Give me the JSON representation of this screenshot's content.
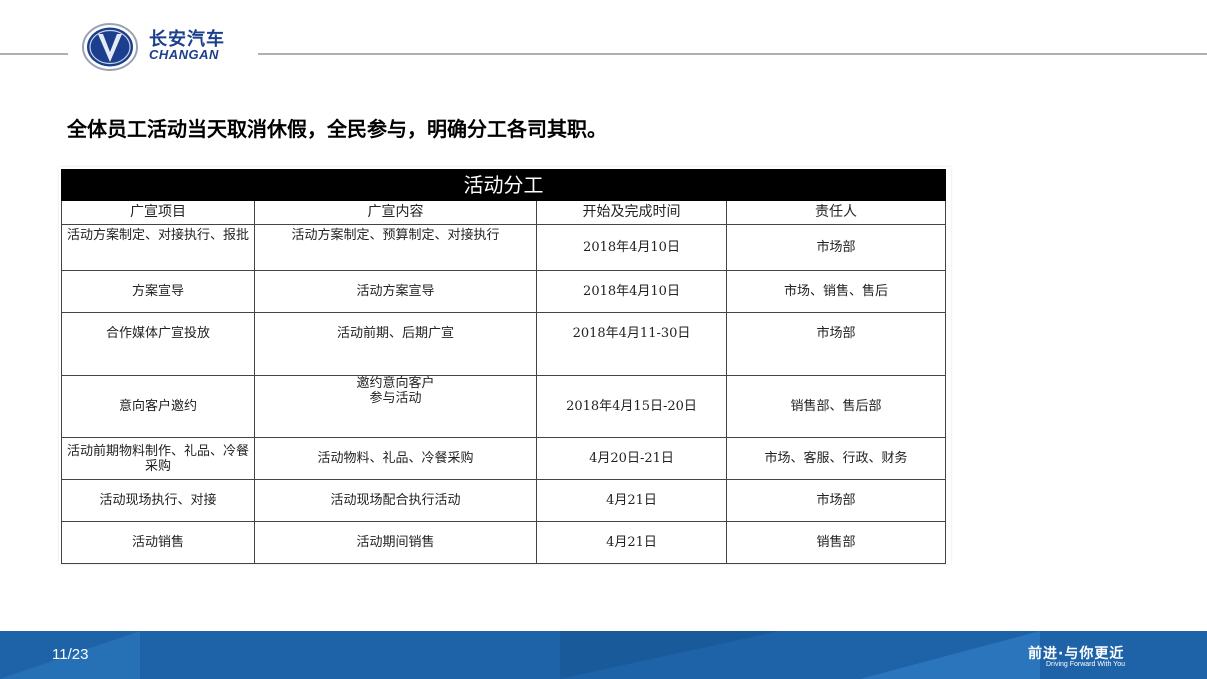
{
  "brand": {
    "name_cn": "长安汽车",
    "name_en": "CHANGAN"
  },
  "headline": "全体员工活动当天取消休假，全民参与，明确分工各司其职。",
  "table": {
    "title": "活动分工",
    "headers": [
      "广宣项目",
      "广宣内容",
      "开始及完成时间",
      "责任人"
    ],
    "rows": [
      [
        "活动方案制定、对接执行、报批",
        "活动方案制定、预算制定、对接执行",
        "2018年4月10日",
        "市场部"
      ],
      [
        "方案宣导",
        "活动方案宣导",
        "2018年4月10日",
        "市场、销售、售后"
      ],
      [
        "合作媒体广宣投放",
        "活动前期、后期广宣",
        "2018年4月11-30日",
        "市场部"
      ],
      [
        "意向客户邀约",
        "邀约意向客户\n参与活动",
        "2018年4月15日-20日",
        "销售部、售后部"
      ],
      [
        "活动前期物料制作、礼品、冷餐采购",
        "活动物料、礼品、冷餐采购",
        "4月20日-21日",
        "市场、客服、行政、财务"
      ],
      [
        "活动现场执行、对接",
        "活动现场配合执行活动",
        "4月21日",
        "市场部"
      ],
      [
        "活动销售",
        "活动期间销售",
        "4月21日",
        "销售部"
      ]
    ]
  },
  "footer": {
    "page_number": "11/23",
    "slogan_cn": "前进·与你更近",
    "slogan_en": "Driving Forward With You"
  },
  "colors": {
    "brand_blue": "#1b3f8c",
    "footer_blue": "#1e63a8",
    "table_title_bg": "#000000"
  }
}
